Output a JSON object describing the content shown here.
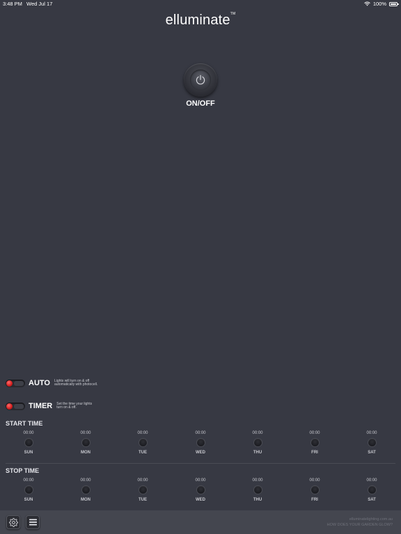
{
  "status_bar": {
    "time": "3:48 PM",
    "date": "Wed Jul 17",
    "battery": "100%"
  },
  "logo": {
    "text": "elluminate",
    "tm": "TM"
  },
  "power": {
    "label": "ON/OFF"
  },
  "auto": {
    "label": "AUTO",
    "description": "Lights will turn on & off automatically with photocell."
  },
  "timer": {
    "label": "TIMER",
    "description": "Set the time your lights turn on & off."
  },
  "start_time": {
    "title": "START TIME",
    "days": [
      {
        "name": "SUN",
        "time": "00:00"
      },
      {
        "name": "MON",
        "time": "00:00"
      },
      {
        "name": "TUE",
        "time": "00:00"
      },
      {
        "name": "WED",
        "time": "00:00"
      },
      {
        "name": "THU",
        "time": "00:00"
      },
      {
        "name": "FRI",
        "time": "00:00"
      },
      {
        "name": "SAT",
        "time": "00:00"
      }
    ]
  },
  "stop_time": {
    "title": "STOP TIME",
    "days": [
      {
        "name": "SUN",
        "time": "00:00"
      },
      {
        "name": "MON",
        "time": "00:00"
      },
      {
        "name": "TUE",
        "time": "00:00"
      },
      {
        "name": "WED",
        "time": "00:00"
      },
      {
        "name": "THU",
        "time": "00:00"
      },
      {
        "name": "FRI",
        "time": "00:00"
      },
      {
        "name": "SAT",
        "time": "00:00"
      }
    ]
  },
  "footer": {
    "line1": "elluminatelighting.com.au",
    "line2": "HOW DOES YOUR GARDEN GLOW?"
  },
  "icons": {
    "settings": "gear-icon",
    "menu": "menu-icon",
    "power": "power-icon"
  },
  "colors": {
    "background": "#373943",
    "toggle_indicator": "#d11d1d",
    "bottom_bar": "#44464f"
  }
}
